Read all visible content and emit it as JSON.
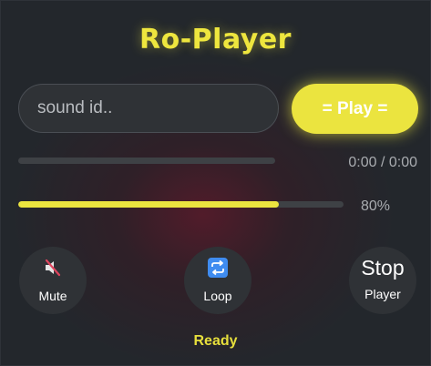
{
  "app": {
    "title": "Ro-Player"
  },
  "search": {
    "placeholder": "sound id..",
    "value": ""
  },
  "play_button": {
    "label": "= Play ="
  },
  "progress": {
    "time_text": "0:00 / 0:00",
    "fraction": 0
  },
  "volume": {
    "text": "80%",
    "fraction": 0.8
  },
  "controls": {
    "mute": {
      "label": "Mute",
      "icon": "muted-speaker-icon"
    },
    "loop": {
      "label": "Loop",
      "icon": "loop-arrows-icon"
    },
    "stop": {
      "label": "Stop",
      "sublabel": "Player"
    }
  },
  "status": {
    "text": "Ready"
  },
  "colors": {
    "accent": "#ebe43f",
    "background": "#23272c",
    "control_bg": "#2f3236",
    "loop_icon_blue": "#3f8cf0",
    "mute_slash_red": "#e0455f"
  }
}
